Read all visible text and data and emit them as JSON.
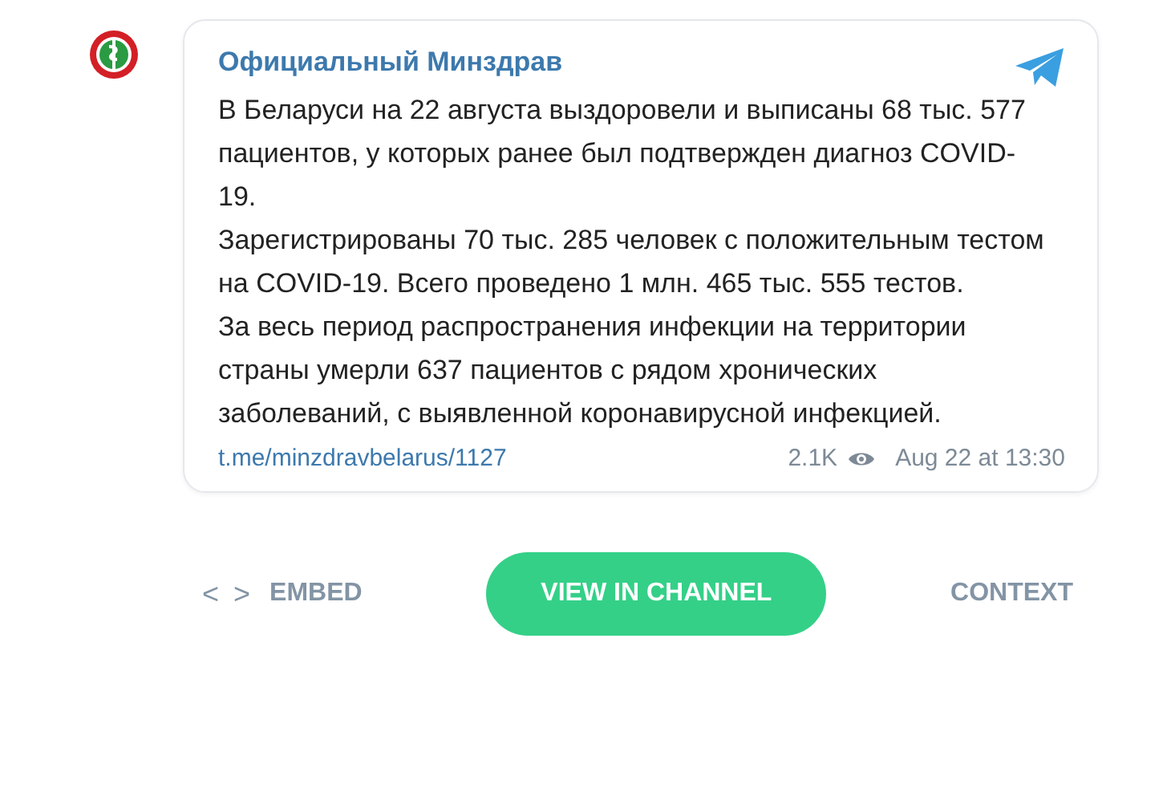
{
  "post": {
    "channel": "Официальный Минздрав",
    "paragraphs": [
      "В Беларуси на 22 августа выздоровели и выписаны 68 тыс. 577 пациентов, у которых ранее был подтвержден диагноз COVID-19.",
      "Зарегистрированы 70 тыс. 285 человек с положительным тестом на COVID-19. Всего проведено 1 млн. 465 тыс. 555 тестов.",
      "За весь период распространения инфекции на территории страны умерли 637 пациентов с рядом хронических заболеваний, с выявленной коронавирусной инфекцией."
    ],
    "link": "t.me/minzdravbelarus/1127",
    "views": "2.1K",
    "date": "Aug 22 at 13:30"
  },
  "actions": [
    {
      "kind": "embed",
      "label": "EMBED",
      "icon": "< >"
    },
    {
      "kind": "primary",
      "label": "VIEW IN CHANNEL"
    },
    {
      "kind": "plain",
      "label": "CONTEXT"
    }
  ]
}
